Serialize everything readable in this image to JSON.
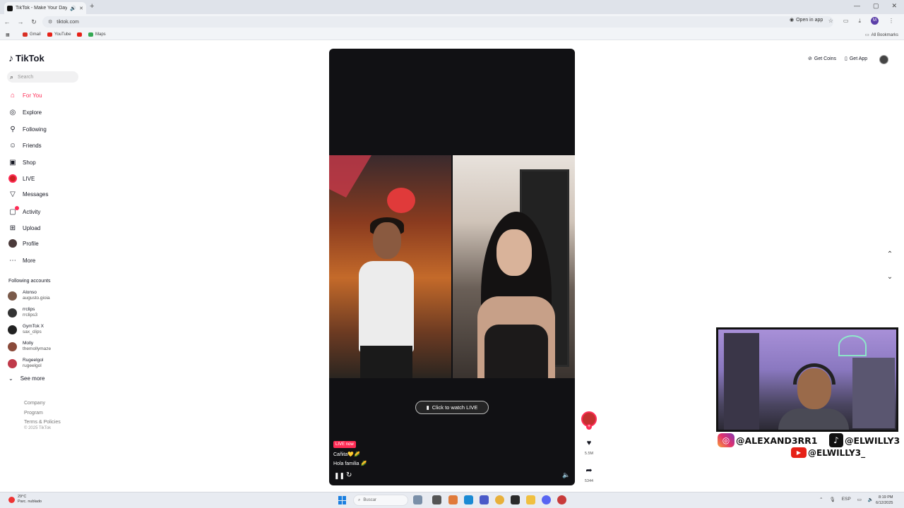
{
  "browser": {
    "tab_title": "TikTok - Make Your Day",
    "new_tab": "+",
    "url": "tiktok.com",
    "open_in_app": "Open in app",
    "bookmarks": [
      {
        "label": "Gmail",
        "color": "#d93025"
      },
      {
        "label": "YouTube",
        "color": "#e62117"
      },
      {
        "label": "Maps",
        "color": "#34a853"
      }
    ],
    "all_bookmarks": "All Bookmarks",
    "profile_initial": "M"
  },
  "sidebar": {
    "logo": "TikTok",
    "search_placeholder": "Search",
    "nav": [
      {
        "label": "For You",
        "icon": "home-icon"
      },
      {
        "label": "Explore",
        "icon": "compass-icon"
      },
      {
        "label": "Following",
        "icon": "following-icon"
      },
      {
        "label": "Friends",
        "icon": "friends-icon"
      },
      {
        "label": "Shop",
        "icon": "shop-icon"
      },
      {
        "label": "LIVE",
        "icon": "live-icon"
      },
      {
        "label": "Messages",
        "icon": "messages-icon"
      },
      {
        "label": "Activity",
        "icon": "activity-icon"
      },
      {
        "label": "Upload",
        "icon": "upload-icon"
      },
      {
        "label": "Profile",
        "icon": "profile-icon"
      },
      {
        "label": "More",
        "icon": "more-icon"
      }
    ],
    "following_title": "Following accounts",
    "accounts": [
      {
        "name": "Alonso",
        "handle": "augusto.gioia"
      },
      {
        "name": "rrclips",
        "handle": "rrclips3"
      },
      {
        "name": "GymTok X",
        "handle": "sax_clips"
      },
      {
        "name": "Molly",
        "handle": "themollymaze"
      },
      {
        "name": "Rugeelgol",
        "handle": "rugeelgol"
      }
    ],
    "see_more": "See more",
    "footer_links": [
      "Company",
      "Program",
      "Terms & Policies"
    ],
    "copyright": "© 2025 TikTok"
  },
  "header": {
    "get_coins": "Get Coins",
    "get_app": "Get App"
  },
  "player": {
    "watch_live": "Click to watch LIVE",
    "live_badge": "LIVE now",
    "caption_1": "Cañita💛🌽",
    "caption_2": "Hola familia 🌽"
  },
  "actions": {
    "like_count": "5.5M",
    "share_count": "5344"
  },
  "overlay": {
    "instagram": "@ALEXAND3RR1",
    "tiktok": "@ELWILLY3",
    "youtube": "@ELWILLY3_"
  },
  "taskbar": {
    "weather_temp": "29°C",
    "weather_desc": "Parc. nublado",
    "search_placeholder": "Buscar",
    "lang": "ESP",
    "time": "8:19 PM",
    "date": "6/12/2025"
  }
}
